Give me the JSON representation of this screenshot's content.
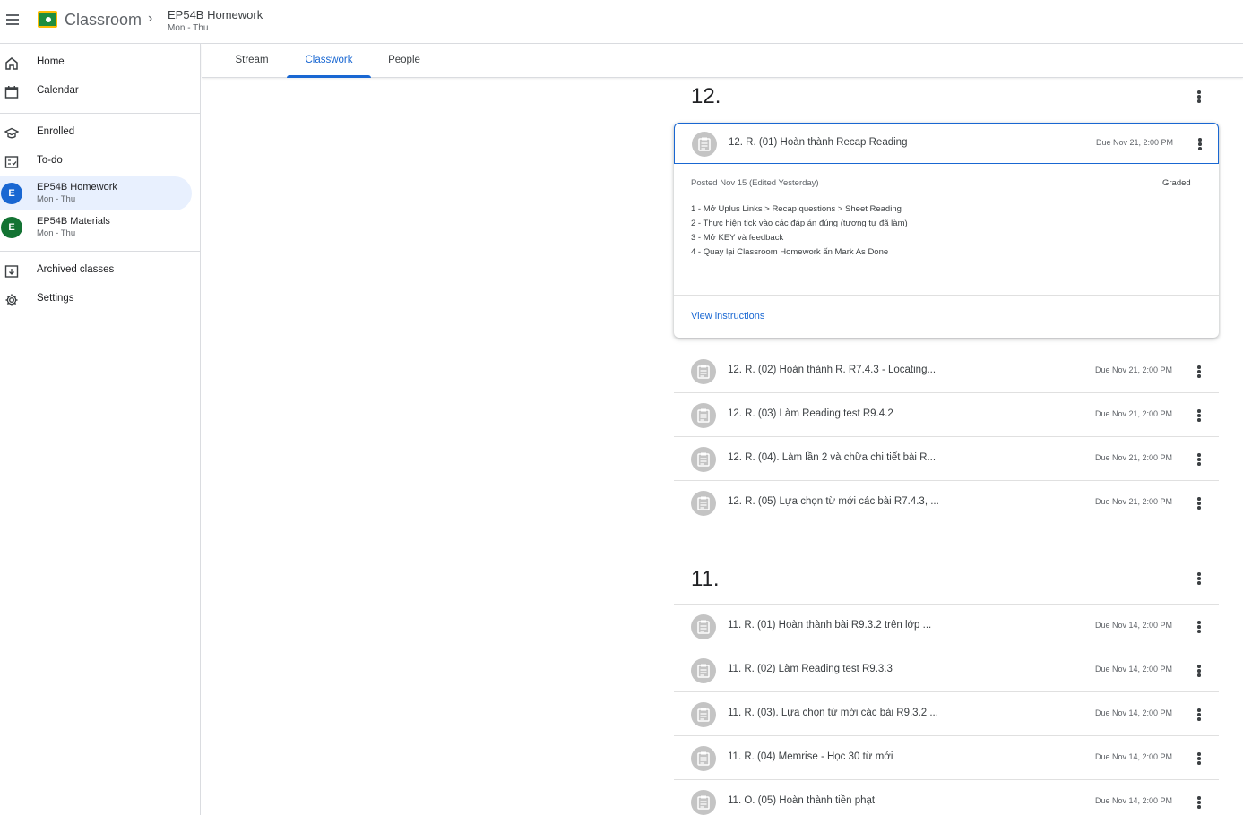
{
  "header": {
    "app_title": "Classroom",
    "class_name": "EP54B Homework",
    "class_schedule": "Mon - Thu"
  },
  "sidebar": {
    "items": [
      {
        "label": "Home",
        "icon": "home-icon"
      },
      {
        "label": "Calendar",
        "icon": "calendar-icon"
      },
      {
        "label": "Enrolled",
        "icon": "graduation-cap-icon"
      },
      {
        "label": "To-do",
        "icon": "todo-checklist-icon"
      },
      {
        "label": "Archived classes",
        "icon": "archive-icon"
      },
      {
        "label": "Settings",
        "icon": "gear-icon"
      }
    ],
    "classes": [
      {
        "initial": "E",
        "name": "EP54B Homework",
        "schedule": "Mon - Thu",
        "color": "#1967d2",
        "active": true
      },
      {
        "initial": "E",
        "name": "EP54B Materials",
        "schedule": "Mon - Thu",
        "color": "#137333",
        "active": false
      }
    ]
  },
  "tabs": [
    {
      "label": "Stream"
    },
    {
      "label": "Classwork",
      "active": true
    },
    {
      "label": "People"
    }
  ],
  "topics": [
    {
      "title": "12.",
      "expanded": {
        "title": "12. R. (01) Hoàn thành Recap Reading",
        "due": "Due Nov 21, 2:00 PM",
        "posted": "Posted Nov 15 (Edited Yesterday)",
        "status": "Graded",
        "instructions": [
          "1 - Mở Uplus Links > Recap questions > Sheet Reading",
          "2 - Thực hiện tick vào các đáp án đúng (tương tự đã làm)",
          "3 - Mở KEY và feedback",
          "4 - Quay lại Classroom Homework ấn Mark As Done"
        ],
        "link": "View instructions"
      },
      "assignments": [
        {
          "title": "12. R. (02) Hoàn thành R. R7.4.3 - Locating...",
          "due": "Due Nov 21, 2:00 PM"
        },
        {
          "title": "12. R. (03) Làm Reading test R9.4.2",
          "due": "Due Nov 21, 2:00 PM"
        },
        {
          "title": "12. R. (04). Làm lần 2 và chữa chi tiết bài R...",
          "due": "Due Nov 21, 2:00 PM"
        },
        {
          "title": "12. R. (05) Lựa chọn từ mới các bài R7.4.3, ...",
          "due": "Due Nov 21, 2:00 PM"
        }
      ]
    },
    {
      "title": "11.",
      "assignments": [
        {
          "title": "11. R. (01) Hoàn thành bài R9.3.2 trên lớp ...",
          "due": "Due Nov 14, 2:00 PM"
        },
        {
          "title": "11. R. (02) Làm Reading test R9.3.3",
          "due": "Due Nov 14, 2:00 PM"
        },
        {
          "title": "11. R. (03). Lựa chọn từ mới các bài R9.3.2 ...",
          "due": "Due Nov 14, 2:00 PM"
        },
        {
          "title": "11. R. (04) Memrise - Học 30 từ mới",
          "due": "Due Nov 14, 2:00 PM"
        },
        {
          "title": "11. O. (05) Hoàn thành tiền phạt",
          "due": "Due Nov 14, 2:00 PM"
        }
      ]
    }
  ],
  "colors": {
    "accent": "#1967d2",
    "active_bg": "#e8f0fe",
    "icon_circle": "#c4c4c4"
  }
}
